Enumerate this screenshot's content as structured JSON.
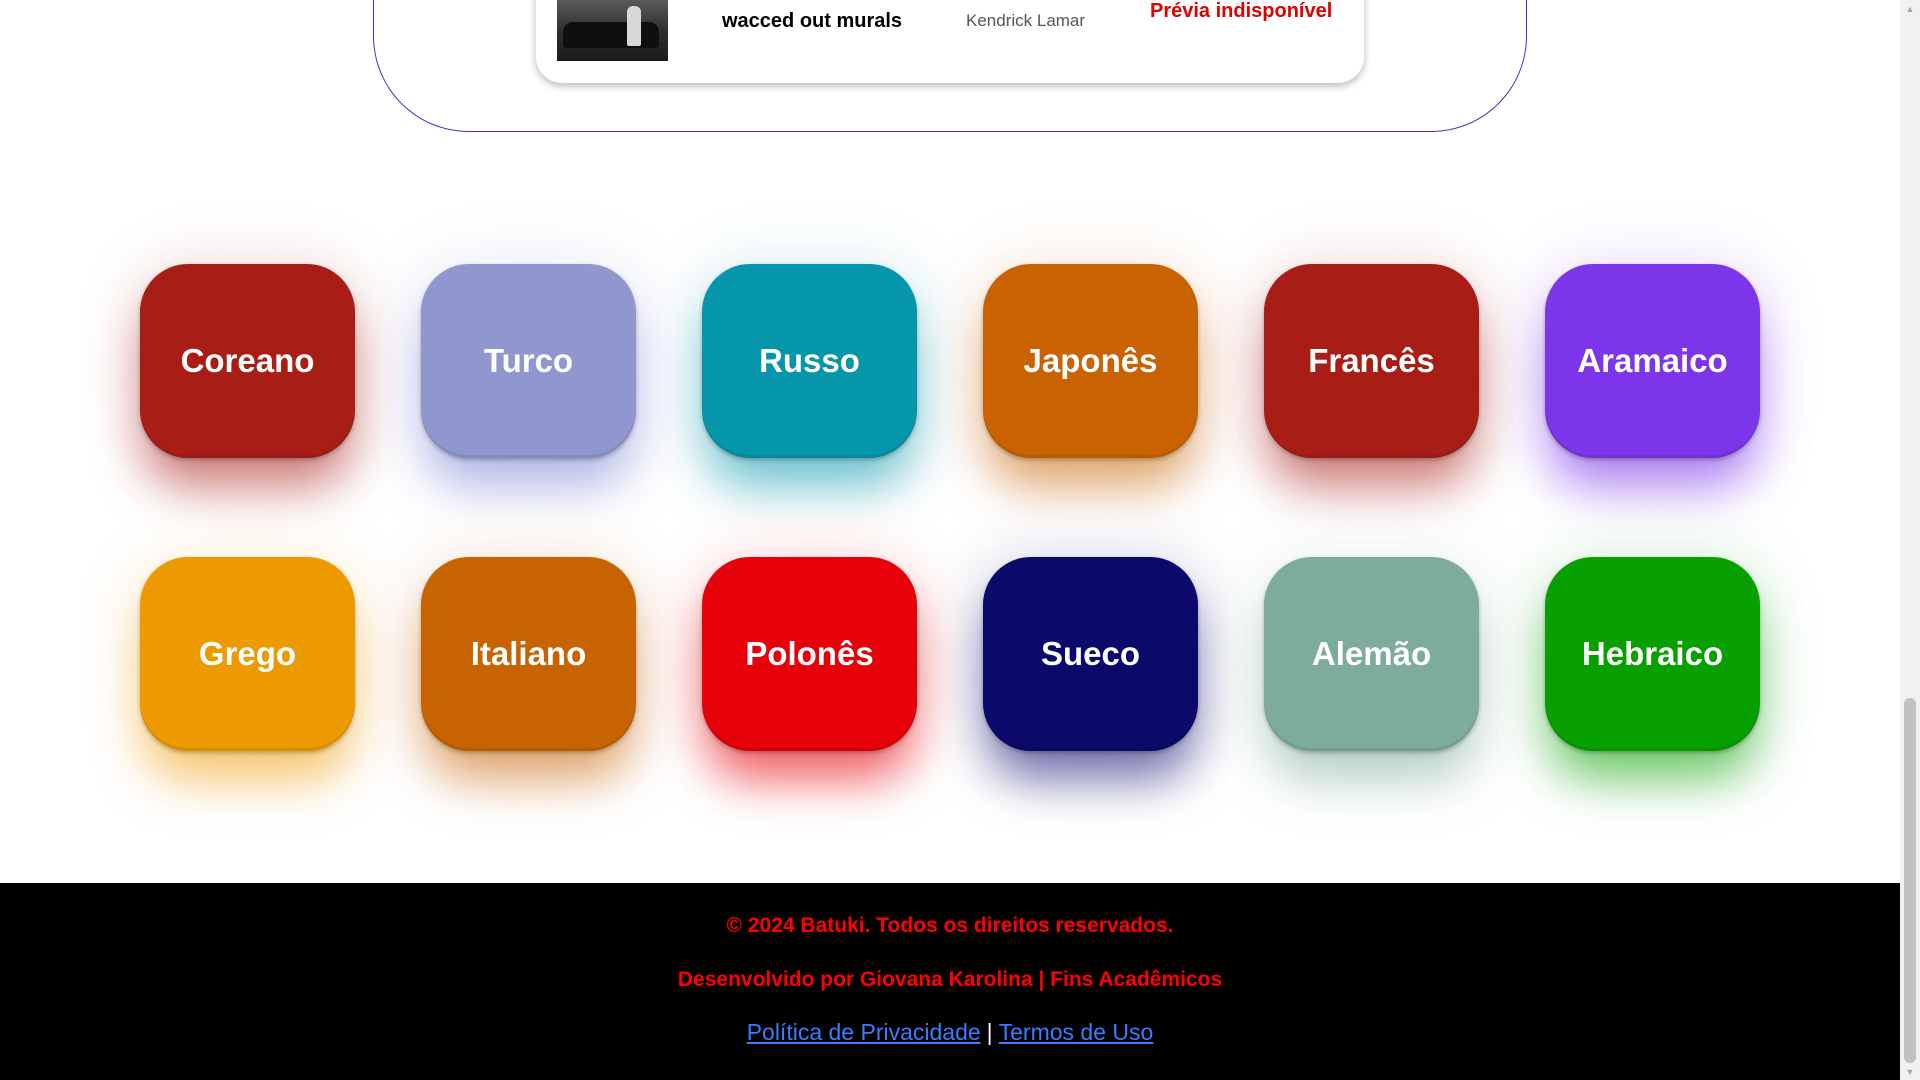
{
  "track": {
    "title": "wacced out murals",
    "artist": "Kendrick Lamar",
    "preview_status": "Prévia indisponível"
  },
  "languages": [
    {
      "label": "Coreano",
      "color": "#a81e16",
      "glow": "rgba(168,30,22,0.55)"
    },
    {
      "label": "Turco",
      "color": "#9097cf",
      "glow": "rgba(120,130,210,0.55)"
    },
    {
      "label": "Russo",
      "color": "#0596ac",
      "glow": "rgba(5,150,172,0.55)"
    },
    {
      "label": "Japonês",
      "color": "#c96302",
      "glow": "rgba(201,99,2,0.55)"
    },
    {
      "label": "Francês",
      "color": "#a81e16",
      "glow": "rgba(168,30,22,0.55)"
    },
    {
      "label": "Aramaico",
      "color": "#7c35e8",
      "glow": "rgba(124,53,232,0.6)"
    },
    {
      "label": "Grego",
      "color": "#ec9a00",
      "glow": "rgba(236,154,0,0.55)"
    },
    {
      "label": "Italiano",
      "color": "#c76300",
      "glow": "rgba(199,99,0,0.55)"
    },
    {
      "label": "Polonês",
      "color": "#e60009",
      "glow": "rgba(230,0,9,0.6)"
    },
    {
      "label": "Sueco",
      "color": "#0b0a6b",
      "glow": "rgba(11,10,107,0.55)"
    },
    {
      "label": "Alemão",
      "color": "#7dab9c",
      "glow": "rgba(125,171,156,0.55)"
    },
    {
      "label": "Hebraico",
      "color": "#07a000",
      "glow": "rgba(7,160,0,0.55)"
    }
  ],
  "footer": {
    "copyright": "© 2024 Batuki. Todos os direitos reservados.",
    "credits": "Desenvolvido por Giovana Karolina | Fins Acadêmicos",
    "privacy_link": "Política de Privacidade",
    "separator": "|",
    "terms_link": "Termos de Uso"
  },
  "colors": {
    "panel_border": "#3b36c9",
    "footer_bg": "#000000",
    "footer_text": "#ff0000",
    "footer_link": "#3d7bff"
  },
  "icons": {
    "scroll_up": "triangle-up-icon",
    "scroll_down": "triangle-down-icon"
  }
}
